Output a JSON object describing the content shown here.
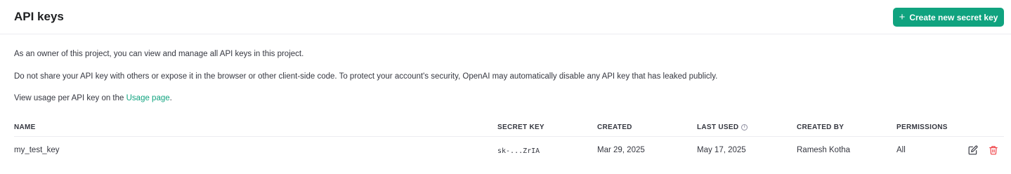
{
  "header": {
    "title": "API keys",
    "create_button": {
      "label": "Create new secret key",
      "icon": "plus-icon",
      "color": "#10a37f"
    }
  },
  "description": {
    "line1": "As an owner of this project, you can view and manage all API keys in this project.",
    "line2": "Do not share your API key with others or expose it in the browser or other client-side code. To protect your account's security, OpenAI may automatically disable any API key that has leaked publicly.",
    "line3_prefix": "View usage per API key on the ",
    "line3_link": "Usage page",
    "line3_suffix": "."
  },
  "table": {
    "columns": [
      "NAME",
      "SECRET KEY",
      "CREATED",
      "LAST USED",
      "CREATED BY",
      "PERMISSIONS"
    ],
    "rows": [
      {
        "name": "my_test_key",
        "secret_key": "sk-...ZrIA",
        "created": "Mar 29, 2025",
        "last_used": "May 17, 2025",
        "created_by": "Ramesh Kotha",
        "permissions": "All",
        "actions": [
          "edit-icon",
          "trash-icon"
        ]
      }
    ]
  },
  "colors": {
    "accent": "#10a37f",
    "danger": "#ef4146"
  }
}
